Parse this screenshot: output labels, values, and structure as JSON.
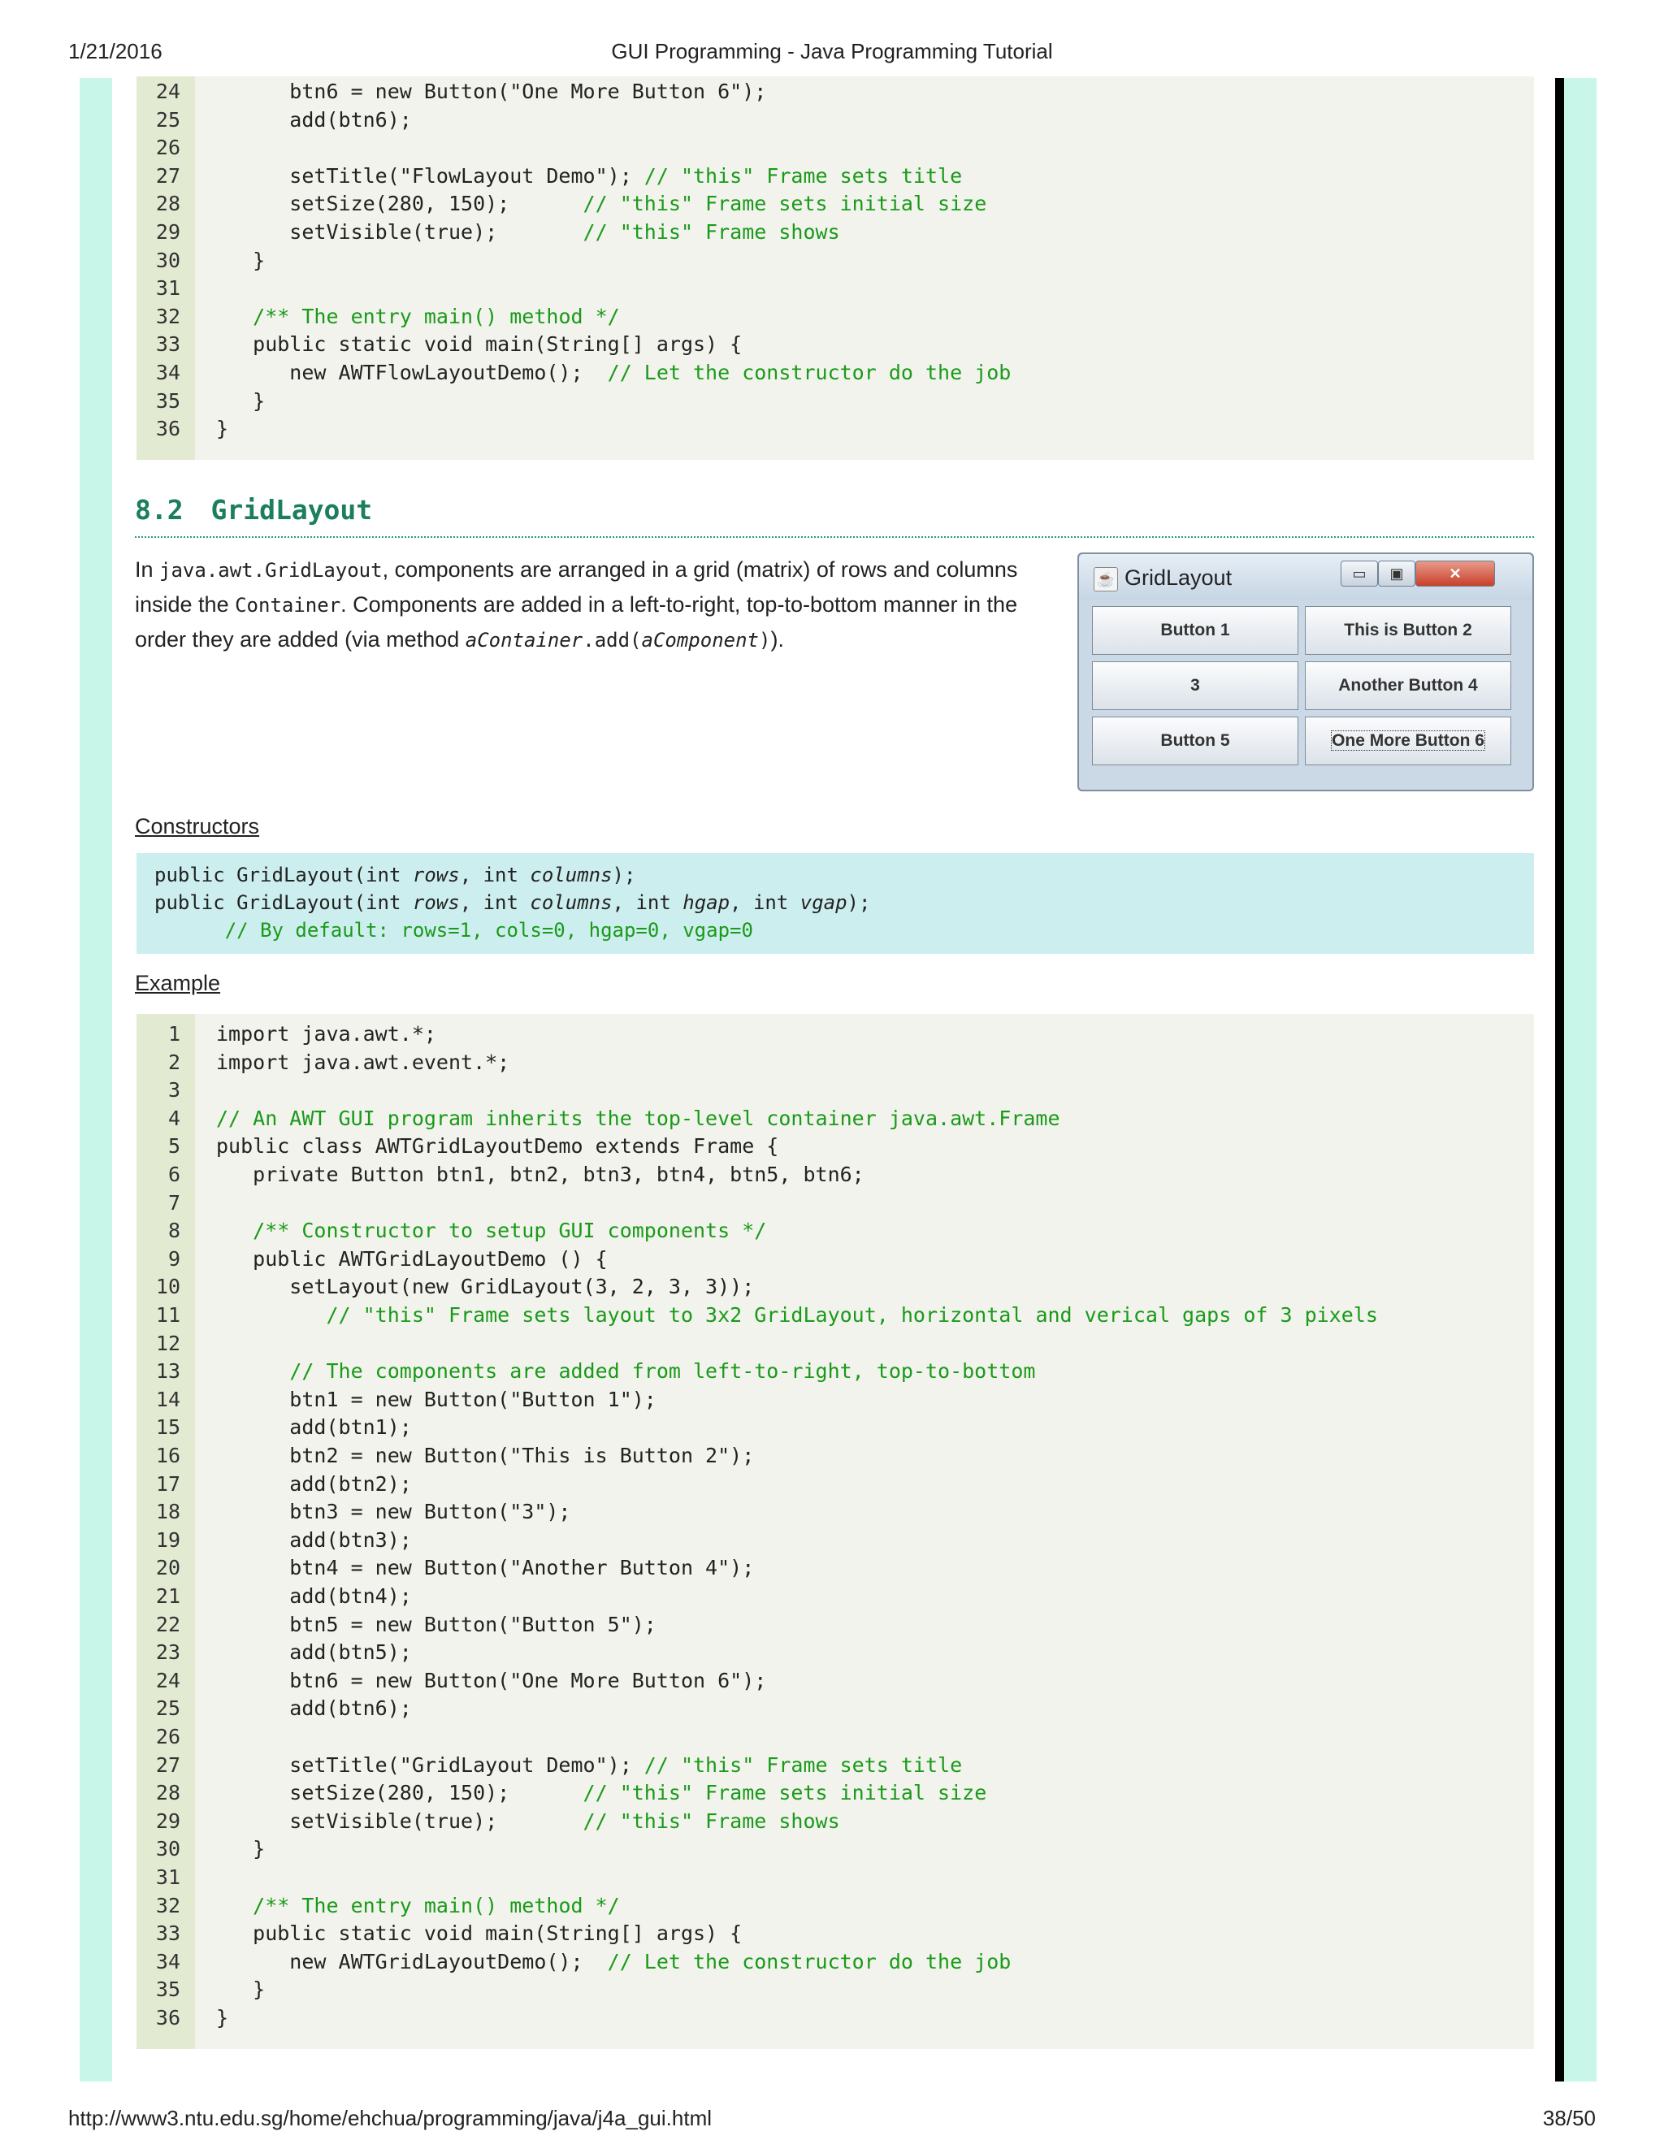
{
  "header": {
    "date": "1/21/2016",
    "title": "GUI Programming - Java Programming Tutorial"
  },
  "footer": {
    "url": "http://www3.ntu.edu.sg/home/ehchua/programming/java/j4a_gui.html",
    "page": "38/50"
  },
  "top_code": [
    {
      "n": "24",
      "code": "      btn6 = new Button(\"One More Button 6\");",
      "comment": ""
    },
    {
      "n": "25",
      "code": "      add(btn6);",
      "comment": ""
    },
    {
      "n": "26",
      "code": "",
      "comment": ""
    },
    {
      "n": "27",
      "code": "      setTitle(\"FlowLayout Demo\"); ",
      "comment": "// \"this\" Frame sets title"
    },
    {
      "n": "28",
      "code": "      setSize(280, 150);      ",
      "comment": "// \"this\" Frame sets initial size"
    },
    {
      "n": "29",
      "code": "      setVisible(true);       ",
      "comment": "// \"this\" Frame shows"
    },
    {
      "n": "30",
      "code": "   }",
      "comment": ""
    },
    {
      "n": "31",
      "code": "",
      "comment": ""
    },
    {
      "n": "32",
      "code": "   ",
      "comment": "/** The entry main() method */"
    },
    {
      "n": "33",
      "code": "   public static void main(String[] args) {",
      "comment": ""
    },
    {
      "n": "34",
      "code": "      new AWTFlowLayoutDemo();  ",
      "comment": "// Let the constructor do the job"
    },
    {
      "n": "35",
      "code": "   }",
      "comment": ""
    },
    {
      "n": "36",
      "code": "}",
      "comment": ""
    }
  ],
  "section": {
    "number": "8.2",
    "title": "GridLayout"
  },
  "intro": {
    "t1": "In ",
    "m1": "java.awt.GridLayout",
    "t2": ", components are arranged in a grid (matrix) of rows and columns inside the ",
    "m2": "Container",
    "t3": ". Components are added in a left-to-right, top-to-bottom manner in the order they are added (via method ",
    "m3": "aContainer",
    "m4": ".add(",
    "m5": "aComponent",
    "m6": ")",
    "t4": ")."
  },
  "window": {
    "title": "GridLayout",
    "buttons": [
      "Button 1",
      "This is Button 2",
      "3",
      "Another Button 4",
      "Button 5",
      "One More Button 6"
    ],
    "minimize": "▭",
    "maximize": "▣",
    "close": "✕"
  },
  "constructors": {
    "label": "Constructors",
    "l1a": "public GridLayout(int ",
    "l1b": "rows",
    "l1c": ", int ",
    "l1d": "columns",
    "l1e": ");",
    "l2a": "public GridLayout(int ",
    "l2b": "rows",
    "l2c": ", int ",
    "l2d": "columns",
    "l2e": ", int ",
    "l2f": "hgap",
    "l2g": ", int ",
    "l2h": "vgap",
    "l2i": ");",
    "l3": "      // By default: rows=1, cols=0, hgap=0, vgap=0"
  },
  "example": {
    "label": "Example"
  },
  "example_code": [
    {
      "n": "1",
      "code": "import java.awt.*;",
      "comment": ""
    },
    {
      "n": "2",
      "code": "import java.awt.event.*;",
      "comment": ""
    },
    {
      "n": "3",
      "code": "",
      "comment": ""
    },
    {
      "n": "4",
      "code": "",
      "comment": "// An AWT GUI program inherits the top-level container java.awt.Frame"
    },
    {
      "n": "5",
      "code": "public class AWTGridLayoutDemo extends Frame {",
      "comment": ""
    },
    {
      "n": "6",
      "code": "   private Button btn1, btn2, btn3, btn4, btn5, btn6;",
      "comment": ""
    },
    {
      "n": "7",
      "code": "",
      "comment": ""
    },
    {
      "n": "8",
      "code": "   ",
      "comment": "/** Constructor to setup GUI components */"
    },
    {
      "n": "9",
      "code": "   public AWTGridLayoutDemo () {",
      "comment": ""
    },
    {
      "n": "10",
      "code": "      setLayout(new GridLayout(3, 2, 3, 3));",
      "comment": ""
    },
    {
      "n": "11",
      "code": "         ",
      "comment": "// \"this\" Frame sets layout to 3x2 GridLayout, horizontal and verical gaps of 3 pixels"
    },
    {
      "n": "12",
      "code": "",
      "comment": ""
    },
    {
      "n": "13",
      "code": "      ",
      "comment": "// The components are added from left-to-right, top-to-bottom"
    },
    {
      "n": "14",
      "code": "      btn1 = new Button(\"Button 1\");",
      "comment": ""
    },
    {
      "n": "15",
      "code": "      add(btn1);",
      "comment": ""
    },
    {
      "n": "16",
      "code": "      btn2 = new Button(\"This is Button 2\");",
      "comment": ""
    },
    {
      "n": "17",
      "code": "      add(btn2);",
      "comment": ""
    },
    {
      "n": "18",
      "code": "      btn3 = new Button(\"3\");",
      "comment": ""
    },
    {
      "n": "19",
      "code": "      add(btn3);",
      "comment": ""
    },
    {
      "n": "20",
      "code": "      btn4 = new Button(\"Another Button 4\");",
      "comment": ""
    },
    {
      "n": "21",
      "code": "      add(btn4);",
      "comment": ""
    },
    {
      "n": "22",
      "code": "      btn5 = new Button(\"Button 5\");",
      "comment": ""
    },
    {
      "n": "23",
      "code": "      add(btn5);",
      "comment": ""
    },
    {
      "n": "24",
      "code": "      btn6 = new Button(\"One More Button 6\");",
      "comment": ""
    },
    {
      "n": "25",
      "code": "      add(btn6);",
      "comment": ""
    },
    {
      "n": "26",
      "code": "",
      "comment": ""
    },
    {
      "n": "27",
      "code": "      setTitle(\"GridLayout Demo\"); ",
      "comment": "// \"this\" Frame sets title"
    },
    {
      "n": "28",
      "code": "      setSize(280, 150);      ",
      "comment": "// \"this\" Frame sets initial size"
    },
    {
      "n": "29",
      "code": "      setVisible(true);       ",
      "comment": "// \"this\" Frame shows"
    },
    {
      "n": "30",
      "code": "   }",
      "comment": ""
    },
    {
      "n": "31",
      "code": "",
      "comment": ""
    },
    {
      "n": "32",
      "code": "   ",
      "comment": "/** The entry main() method */"
    },
    {
      "n": "33",
      "code": "   public static void main(String[] args) {",
      "comment": ""
    },
    {
      "n": "34",
      "code": "      new AWTGridLayoutDemo();  ",
      "comment": "// Let the constructor do the job"
    },
    {
      "n": "35",
      "code": "   }",
      "comment": ""
    },
    {
      "n": "36",
      "code": "}",
      "comment": ""
    }
  ]
}
